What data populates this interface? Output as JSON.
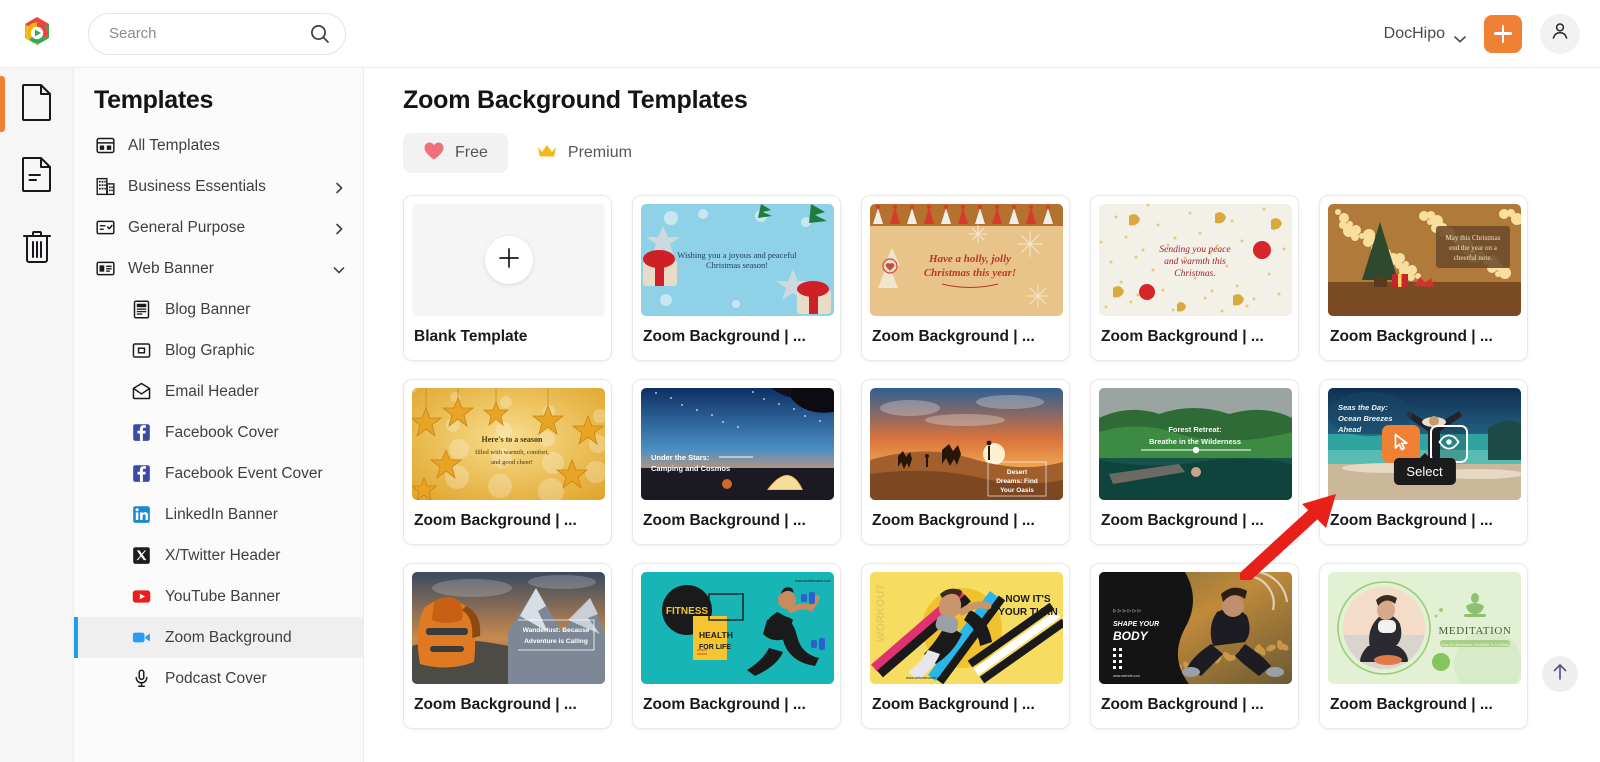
{
  "topbar": {
    "logo_icon": "dochipo-logo-icon",
    "search": {
      "placeholder": "Search",
      "value": "",
      "icon": "search-icon"
    },
    "brand_label": "DocHipo",
    "brand_chevron_icon": "chevron-down-icon",
    "create_button_icon": "plus-icon",
    "avatar_icon": "user-avatar-icon"
  },
  "rail": {
    "items": [
      {
        "name": "documents",
        "icon": "document-icon",
        "active": true
      },
      {
        "name": "drafts",
        "icon": "document-lines-icon",
        "active": false
      },
      {
        "name": "trash",
        "icon": "trash-icon",
        "active": false
      }
    ]
  },
  "sidebar": {
    "title": "Templates",
    "items": [
      {
        "label": "All Templates",
        "icon": "grid-layout-icon",
        "level": 0,
        "arrow": "",
        "selected": false
      },
      {
        "label": "Business Essentials",
        "icon": "building-icon",
        "level": 0,
        "arrow": "right",
        "selected": false
      },
      {
        "label": "General Purpose",
        "icon": "checklist-icon",
        "level": 0,
        "arrow": "right",
        "selected": false
      },
      {
        "label": "Web Banner",
        "icon": "banner-icon",
        "level": 0,
        "arrow": "down",
        "selected": false
      },
      {
        "label": "Blog Banner",
        "icon": "blog-banner-icon",
        "level": 1,
        "arrow": "",
        "selected": false
      },
      {
        "label": "Blog Graphic",
        "icon": "blog-graphic-icon",
        "level": 1,
        "arrow": "",
        "selected": false
      },
      {
        "label": "Email Header",
        "icon": "email-icon",
        "level": 1,
        "arrow": "",
        "selected": false
      },
      {
        "label": "Facebook Cover",
        "icon": "facebook-icon",
        "level": 1,
        "arrow": "",
        "selected": false
      },
      {
        "label": "Facebook Event Cover",
        "icon": "facebook-icon",
        "level": 1,
        "arrow": "",
        "selected": false
      },
      {
        "label": "LinkedIn Banner",
        "icon": "linkedin-icon",
        "level": 1,
        "arrow": "",
        "selected": false
      },
      {
        "label": "X/Twitter Header",
        "icon": "x-twitter-icon",
        "level": 1,
        "arrow": "",
        "selected": false
      },
      {
        "label": "YouTube Banner",
        "icon": "youtube-icon",
        "level": 1,
        "arrow": "",
        "selected": false
      },
      {
        "label": "Zoom Background",
        "icon": "zoom-video-icon",
        "level": 1,
        "arrow": "",
        "selected": true
      },
      {
        "label": "Podcast Cover",
        "icon": "microphone-icon",
        "level": 1,
        "arrow": "",
        "selected": false
      }
    ]
  },
  "main": {
    "page_title": "Zoom Background Templates",
    "filters": [
      {
        "label": "Free",
        "icon": "heart-icon",
        "active": true
      },
      {
        "label": "Premium",
        "icon": "crown-icon",
        "active": false
      }
    ],
    "scroll_top_icon": "arrow-up-icon",
    "hover_overlay": {
      "select_tooltip": "Select",
      "select_icon": "cursor-arrow-icon",
      "preview_icon": "eye-icon"
    },
    "cards": [
      {
        "label": "Blank Template",
        "kind": "blank",
        "plus_icon": "plus-icon",
        "art": "blank"
      },
      {
        "label": "Zoom Background | ...",
        "kind": "template",
        "art": "xmas-blue",
        "art_text": "Wishing you a joyous and peaceful Christmas season!"
      },
      {
        "label": "Zoom Background | ...",
        "kind": "template",
        "art": "xmas-gold",
        "art_text": "Have a holly, jolly Christmas this year!"
      },
      {
        "label": "Zoom Background | ...",
        "kind": "template",
        "art": "xmas-cream",
        "art_text": "Sending you peace and warmth this Christmas."
      },
      {
        "label": "Zoom Background | ...",
        "kind": "template",
        "art": "xmas-lights",
        "art_text": "May this Christmas end the year on a cheerful note."
      },
      {
        "label": "Zoom Background | ...",
        "kind": "template",
        "art": "stars-gold",
        "art_text": "Here's to a season filled with warmth, comfort, and good cheer!"
      },
      {
        "label": "Zoom Background | ...",
        "kind": "template",
        "art": "camping",
        "art_text": "Under the Stars: Camping and Cosmos"
      },
      {
        "label": "Zoom Background | ...",
        "kind": "template",
        "art": "desert",
        "art_text": "Desert Dreams: Find Your Oasis"
      },
      {
        "label": "Zoom Background | ...",
        "kind": "template",
        "art": "forest",
        "art_text": "Forest Retreat: Breathe in the Wilderness"
      },
      {
        "label": "Zoom Background | ...",
        "kind": "template",
        "art": "beach",
        "art_text": "Seas the Day: Ocean Breezes Ahead",
        "hovered": true
      },
      {
        "label": "Zoom Background | ...",
        "kind": "template",
        "art": "backpack",
        "art_text": "Wanderlust: Because Adventure is Calling"
      },
      {
        "label": "Zoom Background | ...",
        "kind": "template",
        "art": "fitness",
        "art_text": "FITNESS HEALTH FOR LIFE"
      },
      {
        "label": "Zoom Background | ...",
        "kind": "template",
        "art": "workout",
        "art_text": "WORKOUT NOW IT'S YOUR TURN"
      },
      {
        "label": "Zoom Background | ...",
        "kind": "template",
        "art": "shape-body",
        "art_text": "SHAPE YOUR BODY"
      },
      {
        "label": "Zoom Background | ...",
        "kind": "template",
        "art": "meditation",
        "art_text": "MEDITATION"
      }
    ]
  },
  "colors": {
    "accent_orange": "#f08033",
    "selected_blue": "#1f9bf0",
    "heart_red": "#f0707a",
    "crown_gold": "#f5b719",
    "tooltip_bg": "#1b1b1b",
    "annotation_red": "#e8201a"
  }
}
